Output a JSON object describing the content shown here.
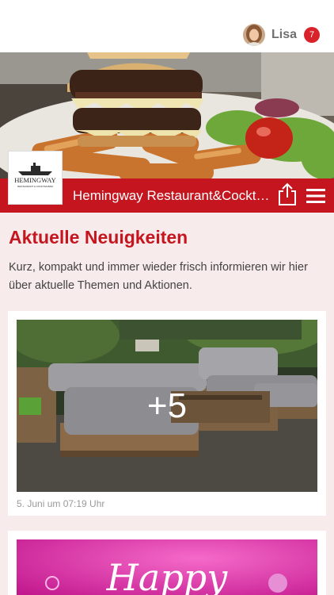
{
  "header": {
    "user_name": "Lisa",
    "notification_count": "7"
  },
  "restaurant": {
    "title": "Hemingway Restaurant&Cocktailbar",
    "logo_text": "HEMINGWAY",
    "logo_subtext": "RESTAURANT & COCKTAILBAR"
  },
  "news": {
    "title": "Aktuelle Neuigkeiten",
    "intro": "Kurz, kompakt und immer wieder frisch informieren wir hier über aktuelle Themen und Aktionen."
  },
  "posts": [
    {
      "more_photos": "+5",
      "date": "5. Juni um 07:19 Uhr"
    },
    {
      "image_text": "Happy"
    }
  ],
  "colors": {
    "brand_red": "#c51620",
    "page_background": "#f7ebeb",
    "badge_red": "#d8232a"
  },
  "icons": [
    "share-icon",
    "hamburger-menu-icon"
  ]
}
